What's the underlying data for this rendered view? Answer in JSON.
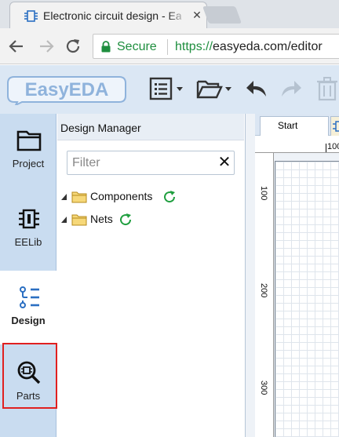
{
  "browser": {
    "tab_title": "Electronic circuit design - EasyEDA",
    "tab_close": "✕",
    "secure_label": "Secure",
    "url_scheme": "https://",
    "url_rest": "easyeda.com/editor"
  },
  "app": {
    "logo_text": "EasyEDA",
    "left_tabs": [
      {
        "label": "Project"
      },
      {
        "label": "EELib"
      },
      {
        "label": "Design"
      },
      {
        "label": "Parts"
      }
    ],
    "design_manager": {
      "title": "Design Manager",
      "filter_placeholder": "Filter",
      "clear_glyph": "✕",
      "tree": [
        {
          "label": "Components"
        },
        {
          "label": "Nets"
        }
      ]
    },
    "document_tabs": [
      {
        "label": "Start"
      }
    ],
    "ruler_top": [
      "100"
    ],
    "ruler_left": [
      "100",
      "200",
      "300"
    ]
  },
  "colors": {
    "accent": "#1e8e3e",
    "app_toolbar": "#dbe7f4",
    "left_tabs_bg": "#c9dcf0",
    "highlight": "#e02020",
    "design_icon": "#2b6fc2"
  }
}
